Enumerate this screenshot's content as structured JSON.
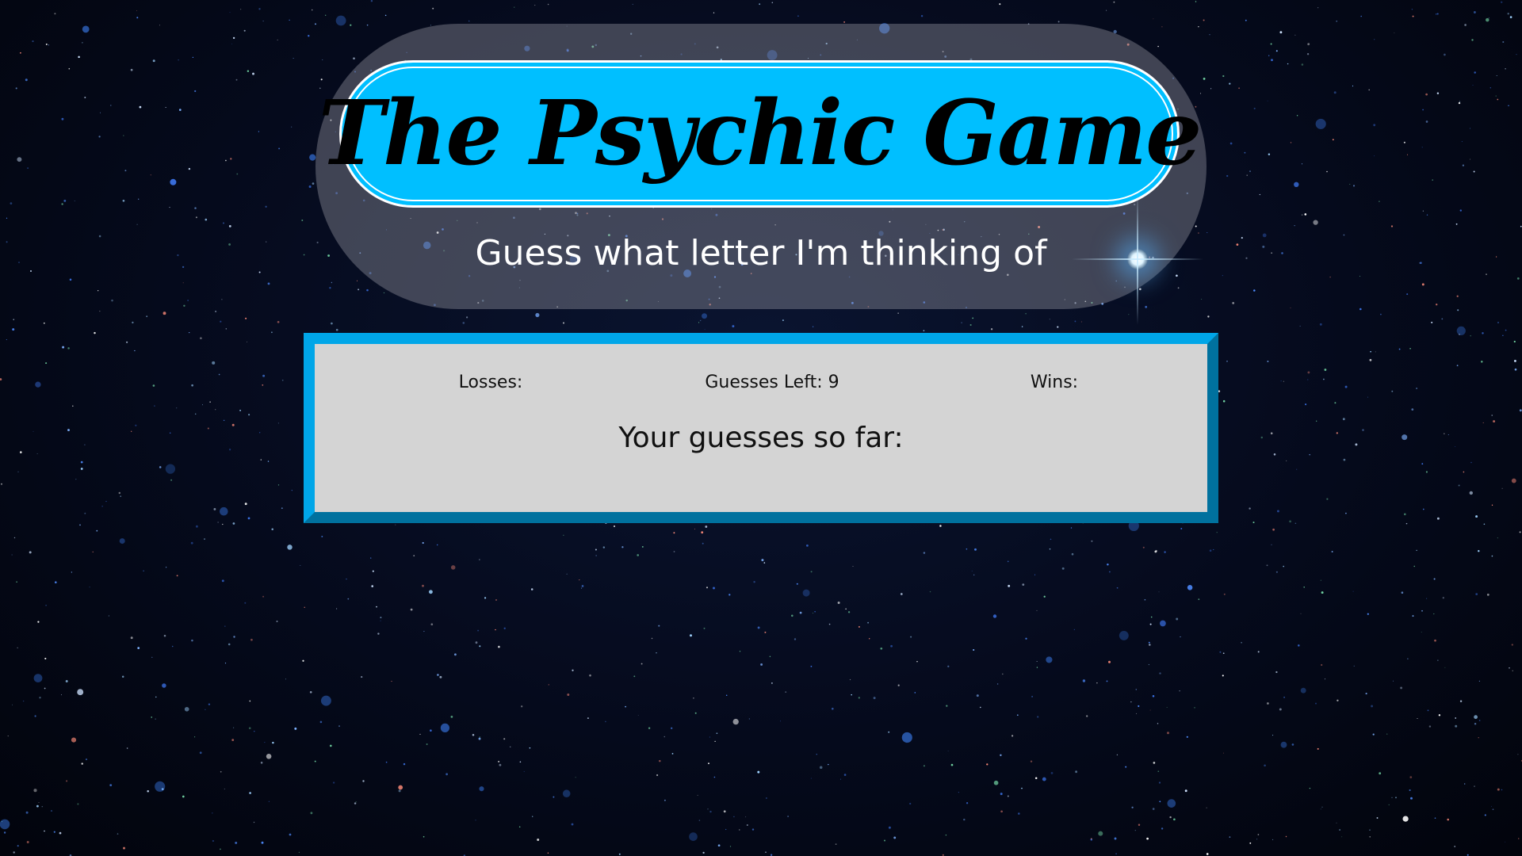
{
  "header": {
    "title": "The Psychic Game",
    "subtitle": "Guess what letter I'm thinking of"
  },
  "stats": {
    "losses_label": "Losses:",
    "losses_value": "",
    "guesses_left_label": "Guesses Left:",
    "guesses_left_value": "9",
    "wins_label": "Wins:",
    "wins_value": ""
  },
  "guesses": {
    "label": "Your guesses so far:",
    "letters": ""
  },
  "colors": {
    "title_pill": "#00bfff",
    "panel_border": "#00a6e8",
    "panel_background": "#d4d4d4",
    "capsule": "rgba(160,160,170,0.38)"
  }
}
